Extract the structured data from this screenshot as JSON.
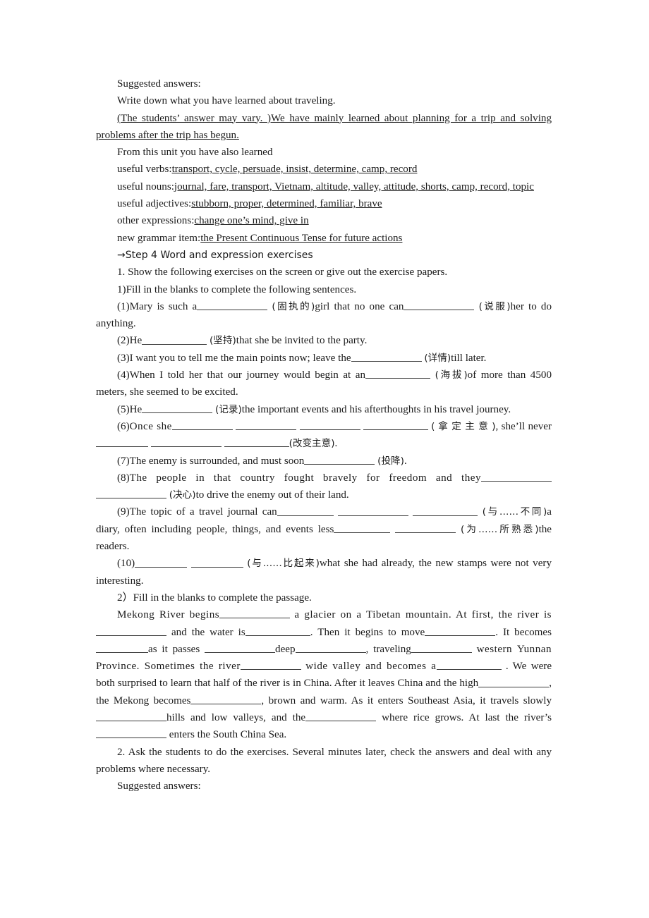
{
  "document": {
    "heading_1": "Suggested answers:",
    "prompt_1": "Write down what you have learned about traveling.",
    "answer_1": "(The students’ answer may vary. )We have mainly learned about planning for a trip and solving problems after the trip has begun.",
    "lead_in": "From this unit you have also learned",
    "lists": [
      {
        "label": "useful verbs:",
        "value": "transport, cycle, persuade, insist, determine, camp, record"
      },
      {
        "label": "useful nouns:",
        "value": "journal, fare, transport, Vietnam, altitude, valley, attitude, shorts, camp, record, topic"
      },
      {
        "label": "useful adjectives:",
        "value": "stubborn, proper, determined, familiar, brave"
      },
      {
        "label": "other expressions:",
        "value": "change one’s mind, give in"
      },
      {
        "label": "new grammar item:",
        "value": "the Present Continuous Tense for future actions"
      }
    ],
    "step4_heading": "→Step 4 Word and expression exercises",
    "task_1": "1. Show the following exercises on the screen or give out the exercise papers.",
    "task_1_sub_1": "1)Fill in the blanks to complete the following sentences.",
    "sentences": [
      {
        "num": "(1)",
        "seg_a": "Mary is such a",
        "hint_a": "(固执的)",
        "seg_b": "girl that no one can",
        "hint_b": "(说服)",
        "seg_c": "her to do anything."
      },
      {
        "num": "(2)",
        "seg_a": "He",
        "hint_a": "(坚持)",
        "seg_b": "that she be invited to the party."
      },
      {
        "num": "(3)",
        "seg_a": "I want you to tell me the main points now; leave the",
        "hint_a": "(详情)",
        "seg_b": "till later."
      },
      {
        "num": "(4)",
        "seg_a": "When I told her that our journey would begin at an",
        "hint_a": "(海拔)",
        "seg_b": "of more than 4500 meters, she seemed to be excited."
      },
      {
        "num": "(5)",
        "seg_a": "He",
        "hint_a": "(记录)",
        "seg_b": "the important events and his afterthoughts in his travel journey."
      },
      {
        "num": "(6)",
        "seg_a": "Once she",
        "hint_a": "( 拿 定 主 意 )",
        "seg_b": ", she’ll never",
        "hint_b": "(改变主意)",
        "seg_c": "."
      },
      {
        "num": "(7)",
        "seg_a": "The enemy is surrounded, and must soon",
        "hint_a": "(投降)",
        "seg_b": "."
      },
      {
        "num": "(8)",
        "seg_a": "The people in that country fought bravely for freedom and they",
        "hint_a": "(决心)",
        "seg_b": "to drive the enemy out of their land."
      },
      {
        "num": "(9)",
        "seg_a": "The topic of a travel journal can",
        "hint_a": "(与……不同)",
        "seg_b": "a diary, often including people, things, and events less",
        "hint_b": "(为……所熟悉)",
        "seg_c": "the readers."
      },
      {
        "num": "(10)",
        "seg_a": "",
        "hint_a": "(与……比起来)",
        "seg_b": "what she had already, the new stamps were not very interesting."
      }
    ],
    "task_1_sub_2": "2）Fill in the blanks to complete the passage.",
    "passage": {
      "p1": "Mekong River begins",
      "p2": "a glacier on a Tibetan mountain. At first, the river is",
      "p3": "and the water is",
      "p4": ". Then it begins to move",
      "p5": ". It becomes",
      "p6": "as it passes",
      "p7": "deep",
      "p8": ", traveling",
      "p9": "western Yunnan Province. Sometimes the river",
      "p10": "wide valley and becomes a",
      "p11": ". We were both surprised to learn that half of the river is in China. After it leaves China and the high",
      "p12": ", the Mekong becomes",
      "p13": ", brown and warm. As it enters Southeast Asia, it travels slowly",
      "p14": "hills and low valleys, and the",
      "p15": "where rice grows. At last the river’s",
      "p16": "enters the South China Sea."
    },
    "task_2": "2. Ask the students to do the exercises. Several minutes later, check the answers and deal with any problems where necessary.",
    "heading_2": "Suggested answers:"
  }
}
